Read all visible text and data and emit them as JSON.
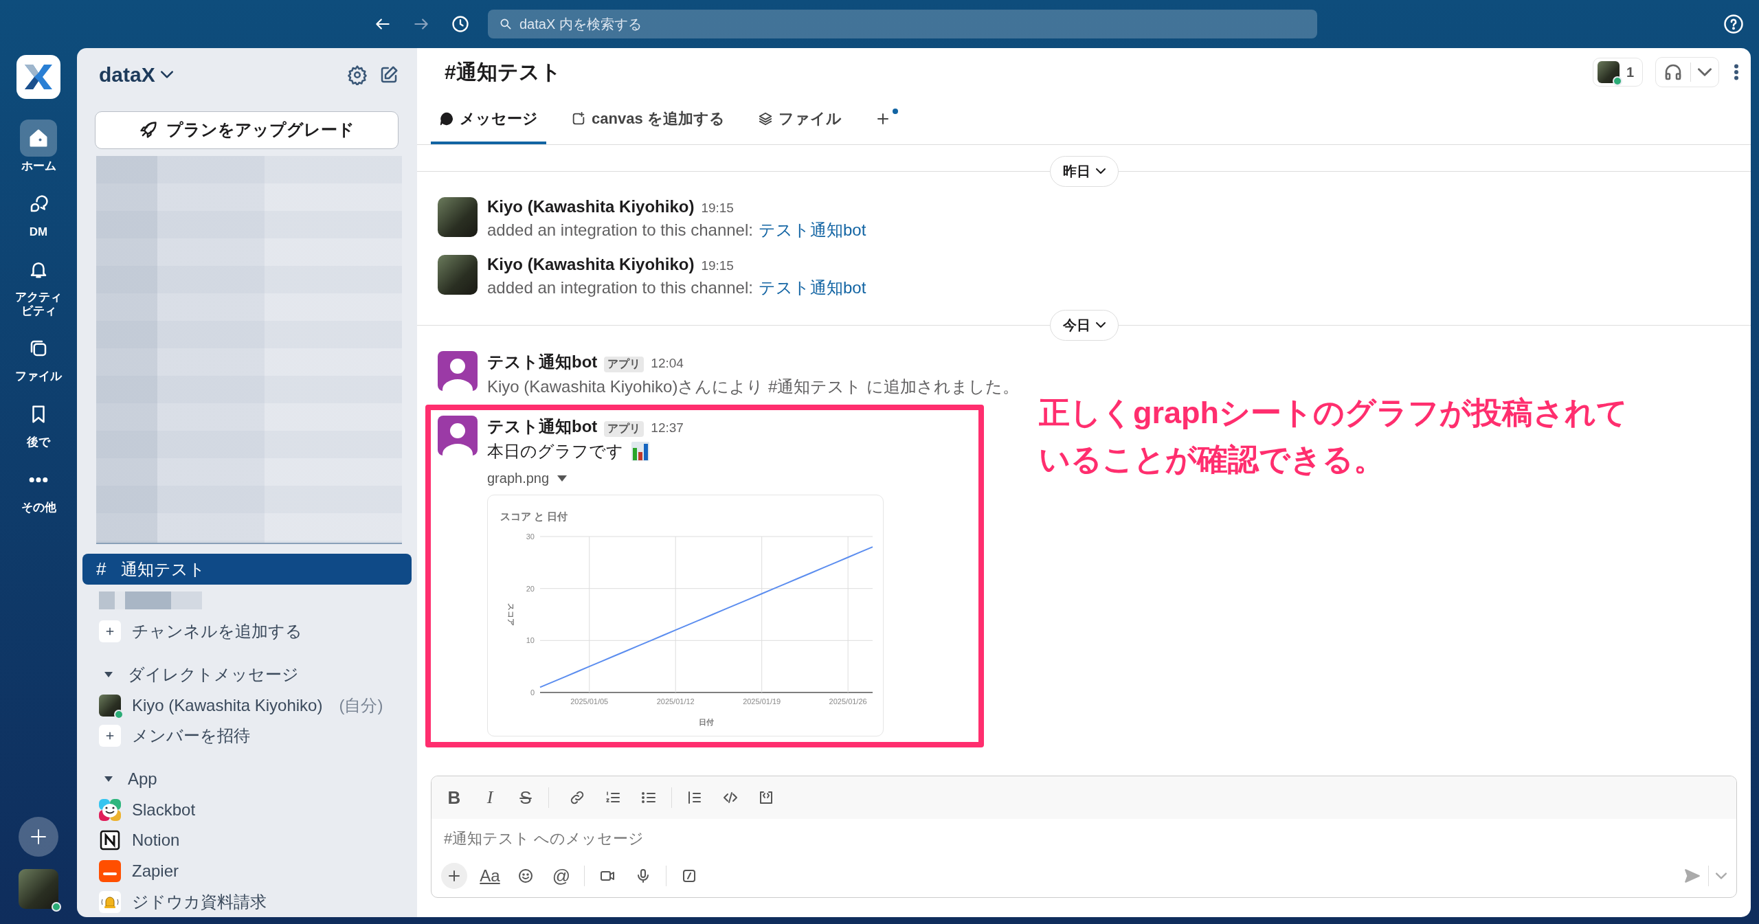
{
  "search": {
    "placeholder": "dataX 内を検索する"
  },
  "rail": {
    "items": [
      {
        "kind": "home",
        "label": "ホーム",
        "selected": true
      },
      {
        "kind": "dm",
        "label": "DM",
        "selected": false
      },
      {
        "kind": "activity",
        "label": "アクティビティ",
        "selected": false
      },
      {
        "kind": "files",
        "label": "ファイル",
        "selected": false
      },
      {
        "kind": "later",
        "label": "後で",
        "selected": false
      },
      {
        "kind": "more",
        "label": "その他",
        "selected": false
      }
    ]
  },
  "sidebar": {
    "workspace": "dataX",
    "upgrade_button": "プランをアップグレード",
    "channels": [
      {
        "icon": "#",
        "name": "通知テスト",
        "selected": true
      }
    ],
    "add_channel": "チャンネルを追加する",
    "sections": [
      {
        "title": "ダイレクトメッセージ",
        "expanded": true,
        "items": [
          {
            "kind": "user",
            "name": "Kiyo (Kawashita Kiyohiko)",
            "suffix": "(自分)"
          },
          {
            "kind": "add",
            "name": "メンバーを招待"
          }
        ]
      },
      {
        "title": "App",
        "expanded": true,
        "items": [
          {
            "kind": "slackbot",
            "name": "Slackbot"
          },
          {
            "kind": "notion",
            "name": "Notion"
          },
          {
            "kind": "zapier",
            "name": "Zapier"
          },
          {
            "kind": "bell",
            "name": "ジドウカ資料請求"
          }
        ]
      }
    ]
  },
  "channel": {
    "title": "#通知テスト",
    "member_count": "1",
    "tabs": [
      {
        "kind": "messages",
        "label": "メッセージ",
        "selected": true
      },
      {
        "kind": "canvas",
        "label": "canvas を追加する",
        "selected": false
      },
      {
        "kind": "files",
        "label": "ファイル",
        "selected": false
      },
      {
        "kind": "add",
        "selected": false
      }
    ]
  },
  "messages": [
    {
      "kind": "divider",
      "label": "昨日"
    },
    {
      "kind": "user_message",
      "author": "Kiyo (Kawashita Kiyohiko)",
      "time": "19:15",
      "text": "added an integration to this channel:",
      "link": "テスト通知bot"
    },
    {
      "kind": "user_message",
      "author": "Kiyo (Kawashita Kiyohiko)",
      "time": "19:15",
      "text": "added an integration to this channel:",
      "link": "テスト通知bot"
    },
    {
      "kind": "divider",
      "label": "今日"
    },
    {
      "kind": "bot_message",
      "author": "テスト通知bot",
      "badge": "アプリ",
      "time": "12:04",
      "text": "Kiyo (Kawashita Kiyohiko)さんにより #通知テスト に追加されました。"
    },
    {
      "kind": "bot_message",
      "author": "テスト通知bot",
      "badge": "アプリ",
      "time": "12:37",
      "text": "本日のグラフです",
      "chart_emoji": true,
      "highlighted": true,
      "annotation": "正しくgraphシートのグラフが投稿されていることが確認できる。",
      "attachment": {
        "file_name": "graph.png",
        "chart_data": {
          "type": "line",
          "title": "スコア と 日付",
          "xlabel": "日付",
          "ylabel": "スコア",
          "categories": [
            null,
            null,
            null,
            null,
            "2025/01/05",
            null,
            null,
            null,
            null,
            null,
            null,
            "2025/01/12",
            null,
            null,
            null,
            null,
            null,
            null,
            "2025/01/19",
            null,
            null,
            null,
            null,
            null,
            null,
            "2025/01/26",
            null,
            null
          ],
          "series": [
            {
              "color": "#5b8def",
              "values": [
                1,
                2,
                3,
                4,
                5,
                6,
                7,
                8,
                9,
                10,
                11,
                12,
                13,
                14,
                15,
                16,
                17,
                18,
                19,
                20,
                21,
                22,
                23,
                24,
                25,
                26,
                27,
                28
              ]
            }
          ],
          "ylim": [
            0,
            30
          ],
          "yticks": [
            0,
            10,
            20,
            30
          ],
          "grid": true
        }
      }
    }
  ],
  "composer": {
    "placeholder": "#通知テスト へのメッセージ",
    "format_buttons": [
      {
        "kind": "bold",
        "label": "B"
      },
      {
        "kind": "italic",
        "label": "I"
      },
      {
        "kind": "strike",
        "label": "S"
      },
      {
        "kind": "sep"
      },
      {
        "kind": "link"
      },
      {
        "kind": "ordered"
      },
      {
        "kind": "bullet"
      },
      {
        "kind": "sep"
      },
      {
        "kind": "quote"
      },
      {
        "kind": "code"
      },
      {
        "kind": "codeblock"
      }
    ],
    "actions": [
      {
        "kind": "plus"
      },
      {
        "kind": "format",
        "label": "Aa"
      },
      {
        "kind": "emoji"
      },
      {
        "kind": "mention",
        "label": "@"
      },
      {
        "kind": "sep"
      },
      {
        "kind": "video"
      },
      {
        "kind": "mic"
      },
      {
        "kind": "sep"
      },
      {
        "kind": "slash"
      }
    ]
  }
}
